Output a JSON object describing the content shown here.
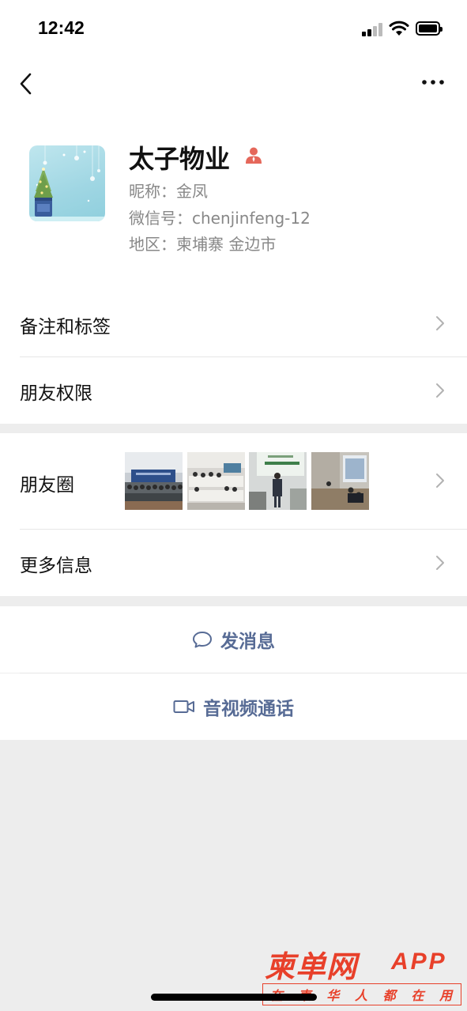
{
  "status_bar": {
    "time": "12:42"
  },
  "profile": {
    "display_name": "太子物业",
    "nickname": "昵称：金凤",
    "wechat_id": "微信号：chenjinfeng-12",
    "region": "地区：柬埔寨 金边市"
  },
  "menu": {
    "remarks_tags": "备注和标签",
    "friend_permissions": "朋友权限",
    "moments": "朋友圈",
    "more_info": "更多信息"
  },
  "actions": {
    "send_message": "发消息",
    "video_call": "音视频通话"
  },
  "watermark": {
    "title": "柬单网",
    "app": "APP",
    "slogan": [
      "在",
      "柬",
      "华",
      "人",
      "都",
      "在",
      "用"
    ]
  },
  "colors": {
    "accent_link": "#576b95",
    "watermark_red": "#e8402a",
    "role_icon": "#e5675a"
  }
}
